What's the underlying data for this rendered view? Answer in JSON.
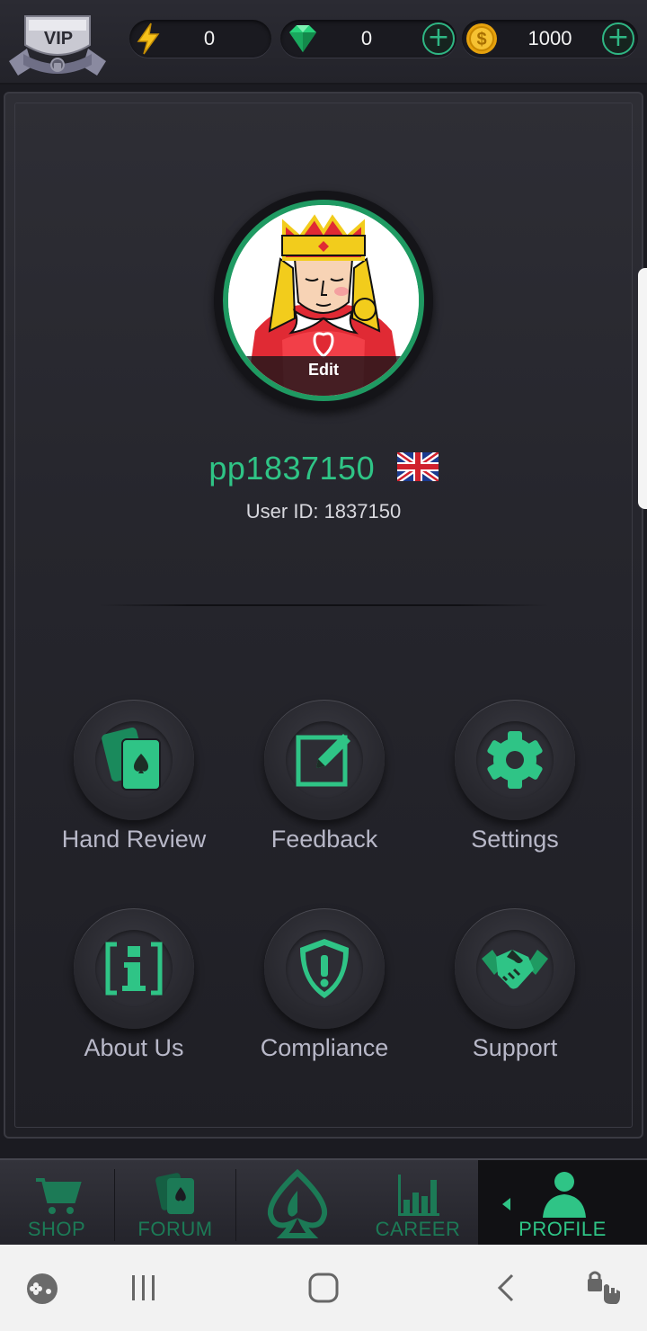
{
  "currency": {
    "energy": "0",
    "gems": "0",
    "coins": "1000"
  },
  "vip_badge": "VIP",
  "profile": {
    "edit_label": "Edit",
    "username": "pp1837150",
    "user_id_label": "User ID: 1837150",
    "flag": "uk-flag-icon"
  },
  "menu": [
    {
      "label": "Hand Review",
      "icon": "cards-icon"
    },
    {
      "label": "Feedback",
      "icon": "edit-icon"
    },
    {
      "label": "Settings",
      "icon": "gear-icon"
    },
    {
      "label": "About Us",
      "icon": "info-icon"
    },
    {
      "label": "Compliance",
      "icon": "shield-icon"
    },
    {
      "label": "Support",
      "icon": "handshake-icon"
    }
  ],
  "nav": [
    {
      "label": "SHOP",
      "icon": "cart-icon"
    },
    {
      "label": "FORUM",
      "icon": "cards-icon"
    },
    {
      "label": "",
      "icon": "spade-icon"
    },
    {
      "label": "CAREER",
      "icon": "bar-chart-icon"
    },
    {
      "label": "PROFILE",
      "icon": "person-icon"
    }
  ],
  "colors": {
    "accent": "#2fc486",
    "nav_inactive": "#1c7a56",
    "menu_text": "#b8b8c8",
    "background": "#1b1b21"
  }
}
